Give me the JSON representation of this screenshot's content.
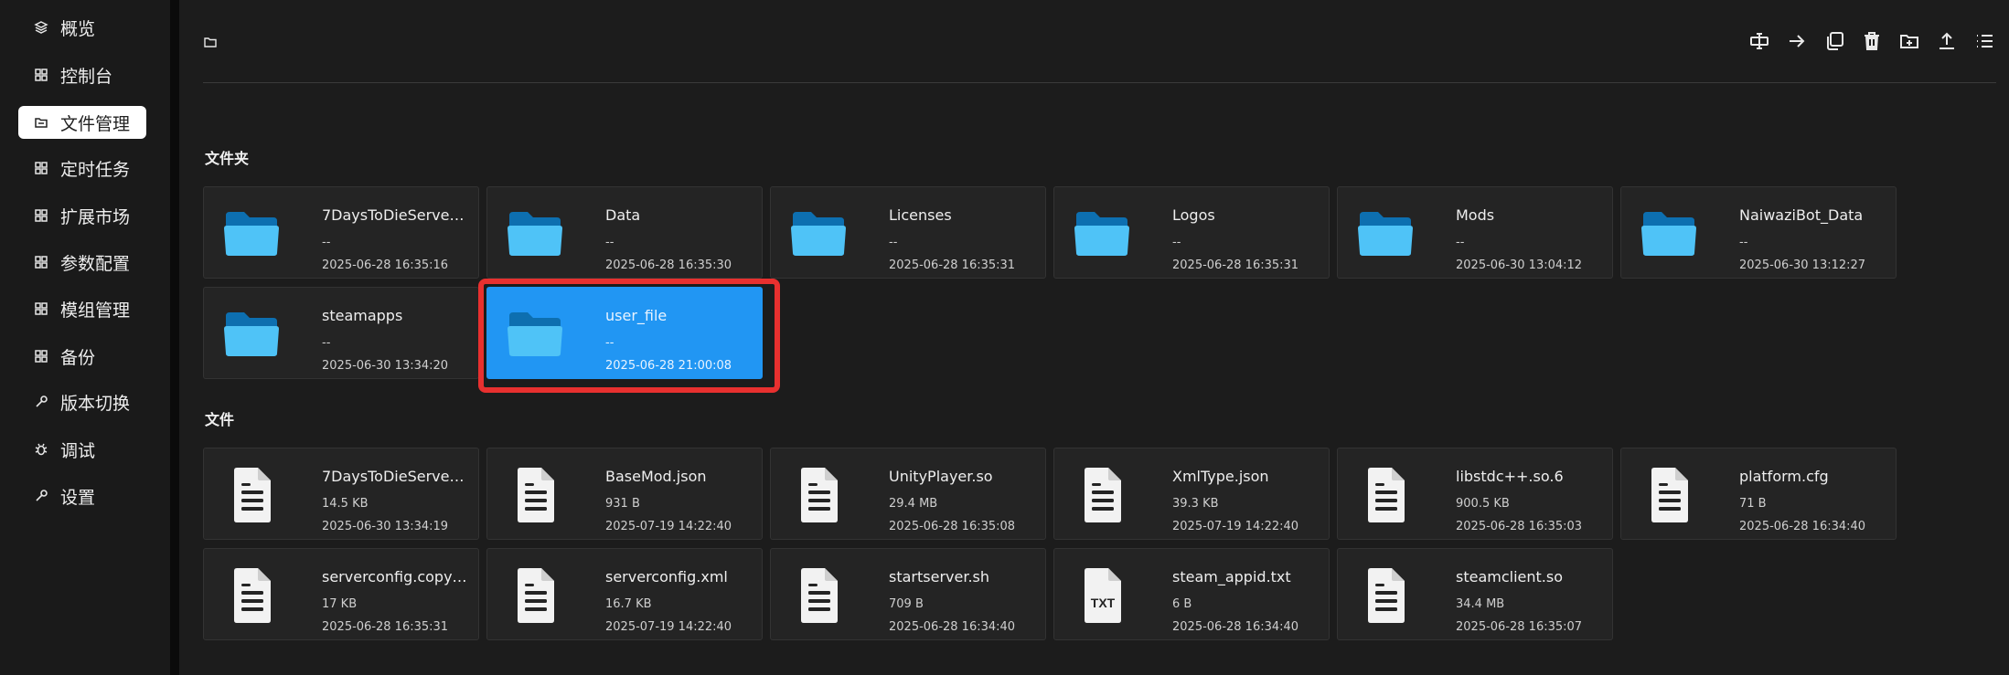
{
  "sidebar": {
    "items": [
      {
        "label": "概览",
        "icon": "layers-icon"
      },
      {
        "label": "控制台",
        "icon": "grid-icon"
      },
      {
        "label": "文件管理",
        "icon": "folder-icon",
        "active": true
      },
      {
        "label": "定时任务",
        "icon": "grid-icon"
      },
      {
        "label": "扩展市场",
        "icon": "grid-icon"
      },
      {
        "label": "参数配置",
        "icon": "grid-icon"
      },
      {
        "label": "模组管理",
        "icon": "grid-icon"
      },
      {
        "label": "备份",
        "icon": "grid-icon"
      },
      {
        "label": "版本切换",
        "icon": "wrench-icon"
      },
      {
        "label": "调试",
        "icon": "bug-icon"
      },
      {
        "label": "设置",
        "icon": "wrench-icon"
      }
    ]
  },
  "toolbar": {
    "buttons": [
      "rename-icon",
      "move-icon",
      "copy-icon",
      "delete-icon",
      "new-folder-icon",
      "upload-icon",
      "list-view-icon"
    ]
  },
  "sections": {
    "folders_title": "文件夹",
    "files_title": "文件"
  },
  "folders": [
    {
      "name": "7DaysToDieServer…",
      "size": "--",
      "date": "2025-06-28 16:35:16"
    },
    {
      "name": "Data",
      "size": "--",
      "date": "2025-06-28 16:35:30"
    },
    {
      "name": "Licenses",
      "size": "--",
      "date": "2025-06-28 16:35:31"
    },
    {
      "name": "Logos",
      "size": "--",
      "date": "2025-06-28 16:35:31"
    },
    {
      "name": "Mods",
      "size": "--",
      "date": "2025-06-30 13:04:12"
    },
    {
      "name": "NaiwaziBot_Data",
      "size": "--",
      "date": "2025-06-30 13:12:27"
    },
    {
      "name": "steamapps",
      "size": "--",
      "date": "2025-06-30 13:34:20"
    },
    {
      "name": "user_file",
      "size": "--",
      "date": "2025-06-28 21:00:08",
      "selected": true
    }
  ],
  "files": [
    {
      "name": "7DaysToDieServer…",
      "size": "14.5 KB",
      "date": "2025-06-30 13:34:19",
      "icon": "document-icon"
    },
    {
      "name": "BaseMod.json",
      "size": "931 B",
      "date": "2025-07-19 14:22:40",
      "icon": "document-icon"
    },
    {
      "name": "UnityPlayer.so",
      "size": "29.4 MB",
      "date": "2025-06-28 16:35:08",
      "icon": "document-icon"
    },
    {
      "name": "XmlType.json",
      "size": "39.3 KB",
      "date": "2025-07-19 14:22:40",
      "icon": "document-icon"
    },
    {
      "name": "libstdc++.so.6",
      "size": "900.5 KB",
      "date": "2025-06-28 16:35:03",
      "icon": "document-icon"
    },
    {
      "name": "platform.cfg",
      "size": "71 B",
      "date": "2025-06-28 16:34:40",
      "icon": "document-icon"
    },
    {
      "name": "serverconfig.copy…",
      "size": "17 KB",
      "date": "2025-06-28 16:35:31",
      "icon": "document-icon"
    },
    {
      "name": "serverconfig.xml",
      "size": "16.7 KB",
      "date": "2025-07-19 14:22:40",
      "icon": "document-icon"
    },
    {
      "name": "startserver.sh",
      "size": "709 B",
      "date": "2025-06-28 16:34:40",
      "icon": "document-icon"
    },
    {
      "name": "steam_appid.txt",
      "size": "6 B",
      "date": "2025-06-28 16:34:40",
      "icon": "txt-file-icon",
      "badge": "TXT"
    },
    {
      "name": "steamclient.so",
      "size": "34.4 MB",
      "date": "2025-06-28 16:35:07",
      "icon": "document-icon"
    }
  ],
  "colors": {
    "background": "#1c1c1c",
    "card": "#242424",
    "selected": "#2196f3",
    "highlight": "#e8302f",
    "folder_front": "#4fc3f7",
    "folder_back": "#0d6fb0"
  }
}
